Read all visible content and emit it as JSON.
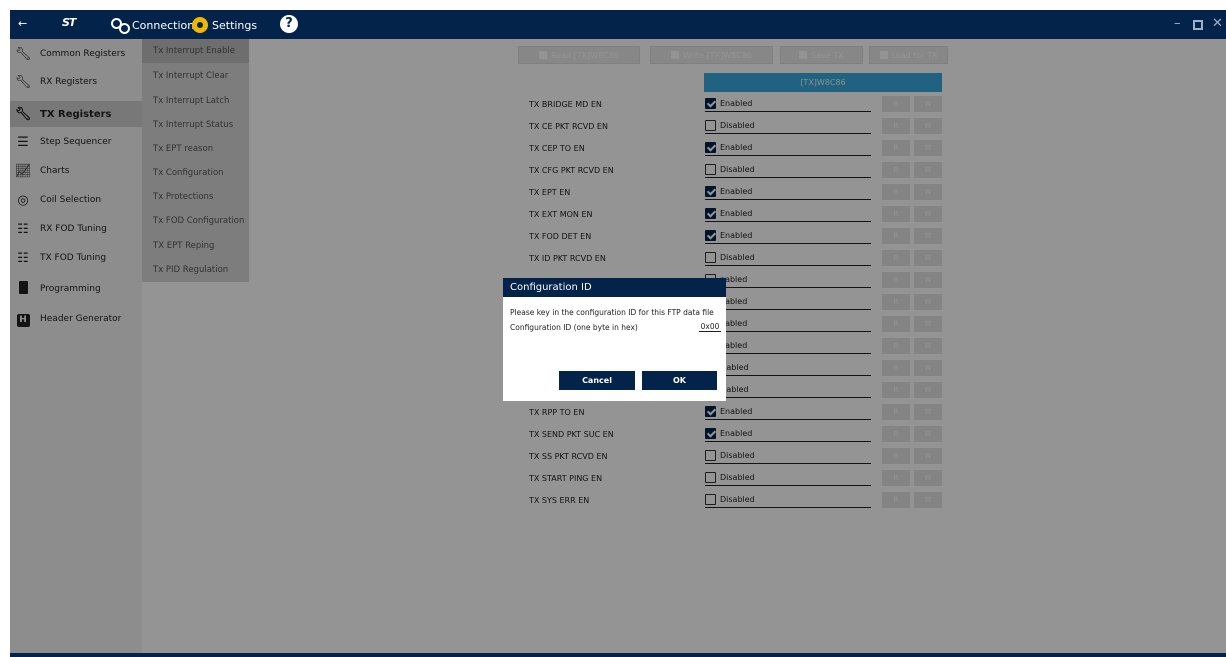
{
  "topbar": {
    "back_icon": "arrow-left-icon",
    "logo_text": "ST",
    "connection_label": "Connection",
    "settings_label": "Settings",
    "help_label": "?",
    "window_controls": {
      "minimize": "–",
      "close": "✕"
    }
  },
  "leftnav": {
    "items": [
      {
        "label": "Common Registers",
        "icon": "wrench-icon"
      },
      {
        "label": "RX Registers",
        "icon": "wrench-icon"
      },
      {
        "label": "TX Registers",
        "icon": "wrench-icon",
        "active": true
      },
      {
        "label": "Step Sequencer",
        "icon": "list-icon"
      },
      {
        "label": "Charts",
        "icon": "chart-icon"
      },
      {
        "label": "Coil Selection",
        "icon": "target-icon"
      },
      {
        "label": "RX FOD Tuning",
        "icon": "sliders-icon"
      },
      {
        "label": "TX FOD Tuning",
        "icon": "sliders-icon"
      },
      {
        "label": "Programming",
        "icon": "chip-icon"
      },
      {
        "label": "Header Generator",
        "icon": "header-icon"
      }
    ]
  },
  "submenu": {
    "items": [
      {
        "label": "Tx Interrupt Enable",
        "active": true
      },
      {
        "label": "Tx Interrupt Clear"
      },
      {
        "label": "Tx Interrupt Latch"
      },
      {
        "label": "Tx Interrupt Status"
      },
      {
        "label": "Tx EPT reason"
      },
      {
        "label": "Tx Configuration"
      },
      {
        "label": "Tx Protections"
      },
      {
        "label": "Tx FOD Configuration"
      },
      {
        "label": "TX EPT Reping"
      },
      {
        "label": "Tx PID Regulation"
      }
    ]
  },
  "toolbar": {
    "read_label": "Read [TX]W8C86",
    "write_label": "Write [TX]W8C86",
    "save_label": "Save TX",
    "load_label": "Load for TX"
  },
  "table": {
    "column_header": "[TX]W8C86",
    "read_label": "R",
    "write_label": "W",
    "rows": [
      {
        "label": "TX BRIDGE MD EN",
        "value": "Enabled",
        "checked": true
      },
      {
        "label": "TX CE PKT RCVD EN",
        "value": "Disabled",
        "checked": false
      },
      {
        "label": "TX CEP TO EN",
        "value": "Enabled",
        "checked": true
      },
      {
        "label": "TX CFG PKT RCVD EN",
        "value": "Disabled",
        "checked": false
      },
      {
        "label": "TX EPT EN",
        "value": "Enabled",
        "checked": true
      },
      {
        "label": "TX EXT MON EN",
        "value": "Enabled",
        "checked": true
      },
      {
        "label": "TX FOD DET EN",
        "value": "Enabled",
        "checked": true
      },
      {
        "label": "TX ID PKT RCVD EN",
        "value": "Disabled",
        "checked": false
      },
      {
        "label": "",
        "value": "nabled",
        "checked": false
      },
      {
        "label": "",
        "value": "nabled",
        "checked": false
      },
      {
        "label": "",
        "value": "nabled",
        "checked": false
      },
      {
        "label": "",
        "value": "nabled",
        "checked": false
      },
      {
        "label": "",
        "value": "isabled",
        "checked": false
      },
      {
        "label": "",
        "value": "isabled",
        "checked": false
      },
      {
        "label": "TX RPP TO EN",
        "value": "Enabled",
        "checked": true
      },
      {
        "label": "TX SEND PKT SUC EN",
        "value": "Enabled",
        "checked": true
      },
      {
        "label": "TX SS PKT RCVD EN",
        "value": "Disabled",
        "checked": false
      },
      {
        "label": "TX START PING EN",
        "value": "Disabled",
        "checked": false
      },
      {
        "label": "TX SYS ERR EN",
        "value": "Disabled",
        "checked": false
      }
    ]
  },
  "dialog": {
    "title": "Configuration ID",
    "message": "Please key in the configuration ID for this FTP data file",
    "field_label": "Configuration ID (one byte in hex)",
    "field_value": "0x00",
    "cancel_label": "Cancel",
    "ok_label": "OK"
  }
}
